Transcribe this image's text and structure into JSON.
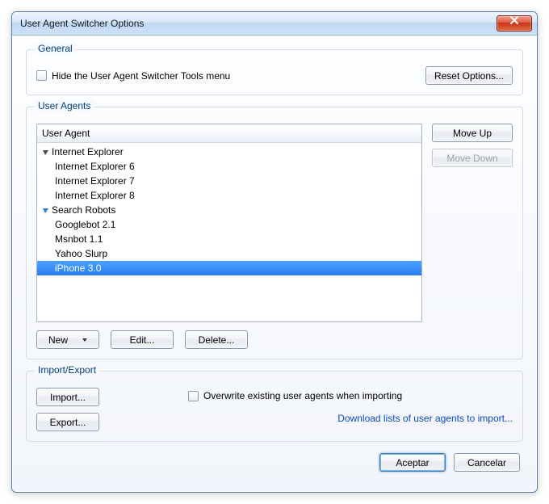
{
  "window": {
    "title": "User Agent Switcher Options"
  },
  "general": {
    "legend": "General",
    "hide_menu_label": "Hide the User Agent Switcher Tools menu",
    "hide_menu_checked": false,
    "reset_button": "Reset Options..."
  },
  "user_agents": {
    "legend": "User Agents",
    "header": "User Agent",
    "move_up": "Move Up",
    "move_down": "Move Down",
    "move_down_disabled": true,
    "new_button": "New",
    "edit_button": "Edit...",
    "delete_button": "Delete...",
    "tree": [
      {
        "label": "Internet Explorer",
        "type": "group",
        "expanded": true,
        "expander": "black",
        "children": [
          {
            "label": "Internet Explorer 6"
          },
          {
            "label": "Internet Explorer 7"
          },
          {
            "label": "Internet Explorer 8"
          }
        ]
      },
      {
        "label": "Search Robots",
        "type": "group",
        "expanded": true,
        "expander": "blue",
        "children": [
          {
            "label": "Googlebot 2.1"
          },
          {
            "label": "Msnbot 1.1"
          },
          {
            "label": "Yahoo Slurp"
          }
        ]
      },
      {
        "label": "iPhone 3.0",
        "type": "item",
        "selected": true
      }
    ]
  },
  "import_export": {
    "legend": "Import/Export",
    "import_button": "Import...",
    "export_button": "Export...",
    "overwrite_label": "Overwrite existing user agents when importing",
    "overwrite_checked": false,
    "download_link": "Download lists of user agents to import..."
  },
  "dialog": {
    "ok": "Aceptar",
    "cancel": "Cancelar"
  }
}
